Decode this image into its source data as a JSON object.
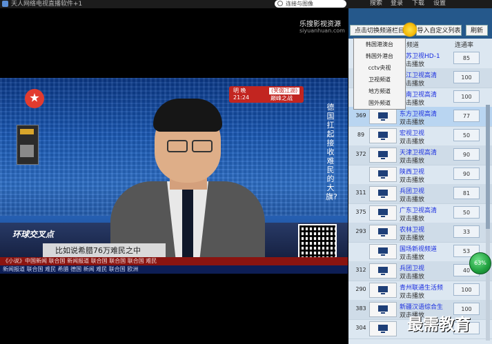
{
  "window": {
    "title": "天人网络电视直播软件+1"
  },
  "search": {
    "placeholder": "连接与图像"
  },
  "menu": [
    "搜索",
    "登录",
    "下载",
    "设置"
  ],
  "brand": {
    "name": "乐搜影视资源",
    "url": "siyuanhuan.com"
  },
  "video": {
    "show_tag_time": "21:24",
    "show_tag_prefix": "明 晚",
    "show_tag_badge": "(笑傲江湖)",
    "show_tag_name": "巅峰之战",
    "vertical_caption": "德国扛起接收难民的大旗?",
    "show_logo": "环球交叉点",
    "subtitle": "比如说希腊76万难民之中",
    "ticker": "《小说》中国新闻 联合国 新闻报道 联合国 联合国 联合国 难民",
    "ticker2": "新闻报道 联合国 难民 希腊 德国 新闻 难民 联合国 欧洲"
  },
  "panel": {
    "switch_button": "点击切换频道栏目",
    "import_button": "导入自定义列表",
    "refresh_button": "刷新",
    "col_source": "频道",
    "col_rate": "连通率"
  },
  "dropdown": [
    "韩国港澳台",
    "韩国外港台",
    "cctv央视",
    "卫视频道",
    "地方频道",
    "国外频道"
  ],
  "channels": [
    {
      "id": "",
      "name": "江苏卫视HD-1",
      "source": "双击播放",
      "rate": "85"
    },
    {
      "id": "",
      "name": "浙江卫视高清",
      "source": "双击播放",
      "rate": "100"
    },
    {
      "id": "",
      "name": "湖南卫视高清",
      "source": "双击播放",
      "rate": "100"
    },
    {
      "id": "369",
      "name": "东方卫视高清",
      "source": "双击播放",
      "rate": "77"
    },
    {
      "id": "89",
      "name": "宏视卫视",
      "source": "双击播放",
      "rate": "50"
    },
    {
      "id": "372",
      "name": "天津卫视高清",
      "source": "双击播放",
      "rate": "90"
    },
    {
      "id": "",
      "name": "陕西卫视",
      "source": "双击播放",
      "rate": "90"
    },
    {
      "id": "311",
      "name": "兵团卫视",
      "source": "双击播放",
      "rate": "81"
    },
    {
      "id": "375",
      "name": "广东卫视高清",
      "source": "双击播放",
      "rate": "50"
    },
    {
      "id": "293",
      "name": "农林卫视",
      "source": "双击播放",
      "rate": "33"
    },
    {
      "id": "",
      "name": "国场新视频道",
      "source": "双击播放",
      "rate": "53"
    },
    {
      "id": "312",
      "name": "兵团卫视",
      "source": "双击播放",
      "rate": "40"
    },
    {
      "id": "290",
      "name": "青州联通生活频",
      "source": "双击播放",
      "rate": "100"
    },
    {
      "id": "383",
      "name": "新疆汉语综合生",
      "source": "双击播放",
      "rate": "100"
    },
    {
      "id": "304",
      "name": "",
      "source": "",
      "rate": ""
    }
  ],
  "progress": {
    "label": "63%"
  },
  "watermark": "最需教育"
}
